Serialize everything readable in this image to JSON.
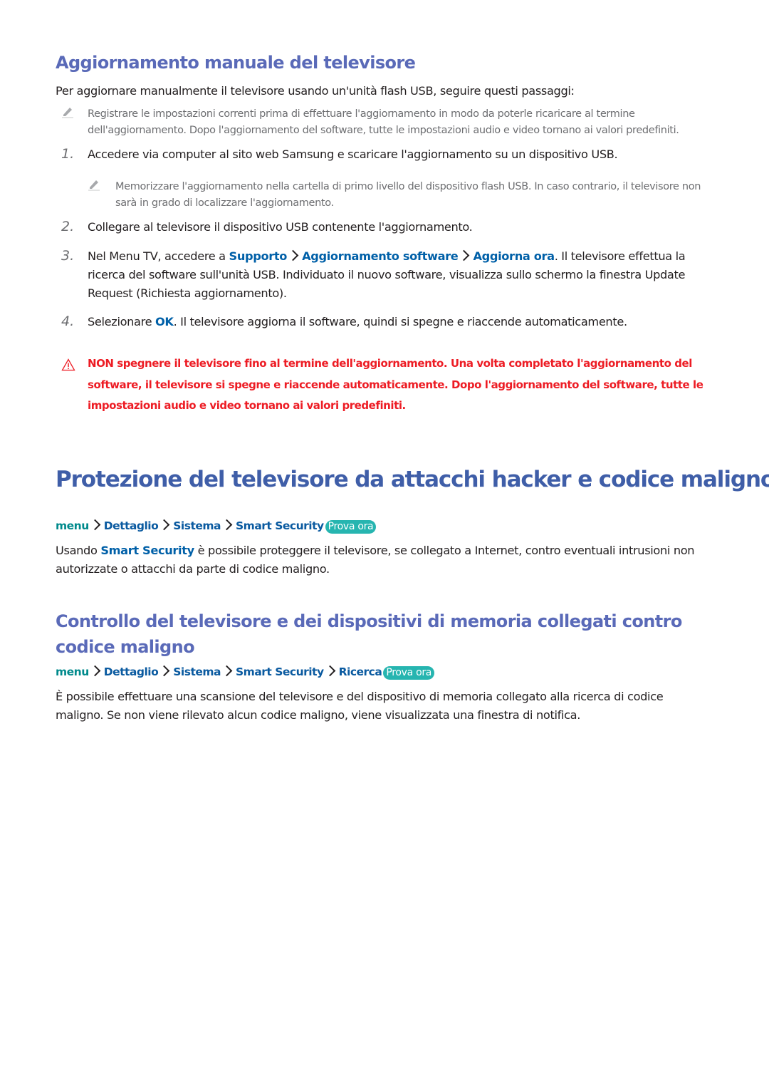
{
  "section1": {
    "title": "Aggiornamento manuale del televisore",
    "intro": "Per aggiornare manualmente il televisore usando un'unità flash USB, seguire questi passaggi:",
    "note": "Registrare le impostazioni correnti prima di effettuare l'aggiornamento in modo da poterle ricaricare al termine dell'aggiornamento. Dopo l'aggiornamento del software, tutte le impostazioni audio e video tornano ai valori predefiniti.",
    "steps": [
      {
        "number": "1.",
        "text": "Accedere via computer al sito web Samsung e scaricare l'aggiornamento su un dispositivo USB.",
        "note": "Memorizzare l'aggiornamento nella cartella di primo livello del dispositivo flash USB. In caso contrario, il televisore non sarà in grado di localizzare l'aggiornamento."
      },
      {
        "number": "2.",
        "text": "Collegare al televisore il dispositivo USB contenente l'aggiornamento."
      },
      {
        "number": "3.",
        "text_before": "Nel Menu TV, accedere a ",
        "path": [
          "Supporto",
          "Aggiornamento software",
          "Aggiorna ora"
        ],
        "text_after": ". Il televisore effettua la ricerca del software sull'unità USB. Individuato il nuovo software, visualizza sullo schermo la finestra Update Request (Richiesta aggiornamento)."
      },
      {
        "number": "4.",
        "text_before": "Selezionare ",
        "highlight": "OK",
        "text_after": ". Il televisore aggiorna il software, quindi si spegne e riaccende automaticamente."
      }
    ],
    "warning": "NON spegnere il televisore fino al termine dell'aggiornamento. Una volta completato l'aggiornamento del software, il televisore si spegne e riaccende automaticamente. Dopo l'aggiornamento del software, tutte le impostazioni audio e video tornano ai valori predefiniti."
  },
  "section2": {
    "title": "Protezione del televisore da attacchi hacker e codice maligno",
    "path": [
      "menu",
      "Dettaglio",
      "Sistema",
      "Smart Security"
    ],
    "try_now": "Prova ora",
    "body_before": "Usando ",
    "body_highlight": "Smart Security",
    "body_after": " è possibile proteggere il televisore, se collegato a Internet, contro eventuali intrusioni non autorizzate o attacchi da parte di codice maligno."
  },
  "section3": {
    "title": "Controllo del televisore e dei dispositivi di memoria collegati contro codice maligno",
    "path": [
      "menu",
      "Dettaglio",
      "Sistema",
      "Smart Security",
      "Ricerca"
    ],
    "try_now": "Prova ora",
    "body": "È possibile effettuare una scansione del televisore e del dispositivo di memoria collegato alla ricerca di codice maligno. Se non viene rilevato alcun codice maligno, viene visualizzata una finestra di notifica."
  },
  "colors": {
    "heading": "#5a6ab8",
    "main_heading": "#3f5ea8",
    "link": "#0060a8",
    "menu_teal": "#008a8c",
    "badge": "#26b5b0",
    "warning": "#ed1c24",
    "note": "#6d6e71"
  }
}
